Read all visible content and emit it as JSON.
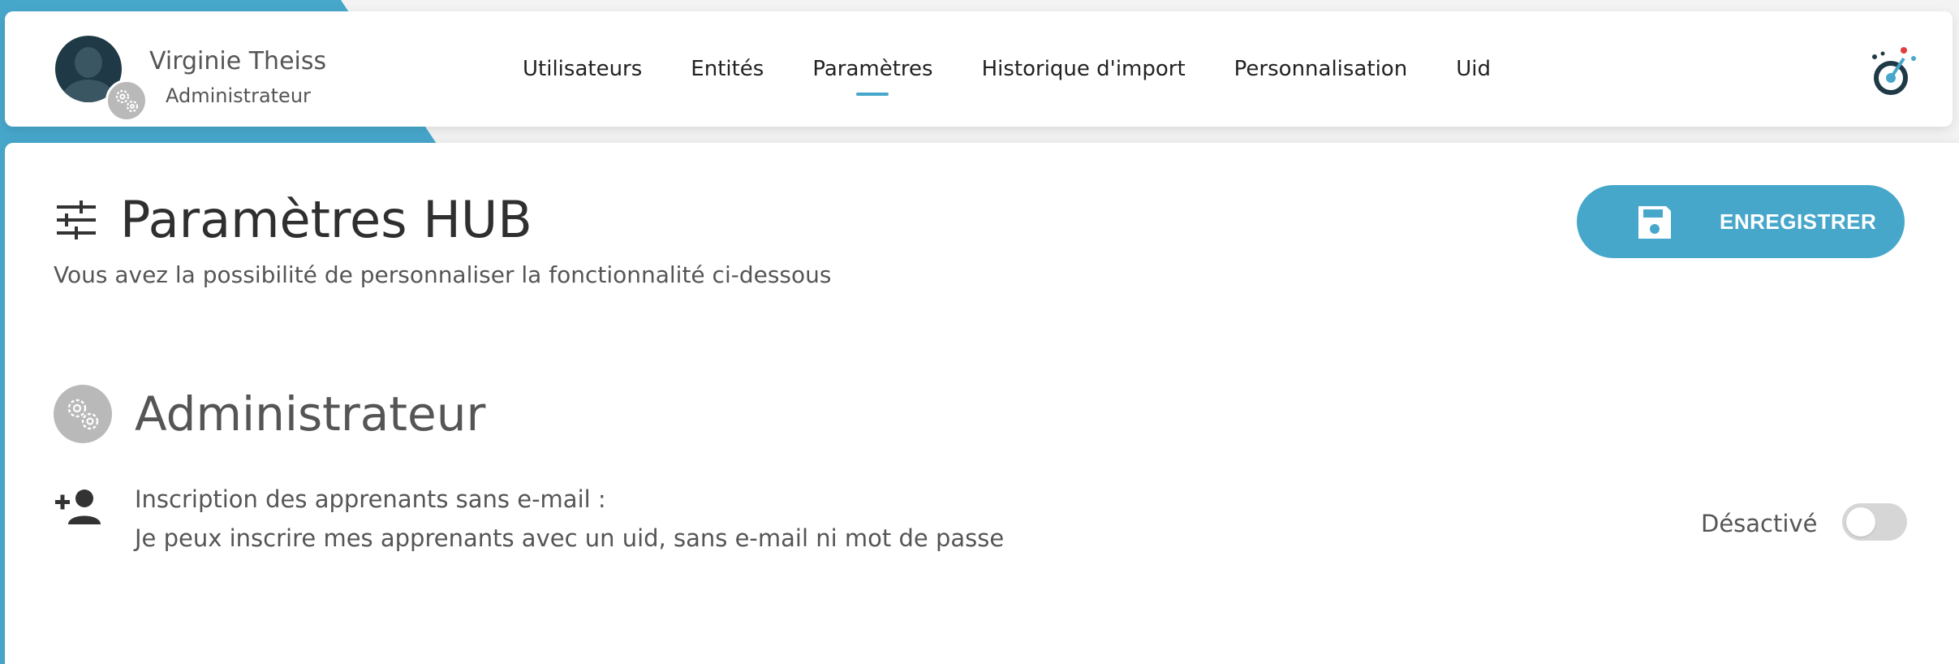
{
  "header": {
    "user": {
      "name": "Virginie Theiss",
      "role": "Administrateur",
      "avatar_icon": "user-avatar",
      "badge_icon": "gears-icon"
    },
    "nav": [
      {
        "label": "Utilisateurs",
        "active": false
      },
      {
        "label": "Entités",
        "active": false
      },
      {
        "label": "Paramètres",
        "active": true
      },
      {
        "label": "Historique d'import",
        "active": false
      },
      {
        "label": "Personnalisation",
        "active": false
      },
      {
        "label": "Uid",
        "active": false
      }
    ],
    "brand_icon": "target-logo-icon"
  },
  "main": {
    "title_icon": "sliders-icon",
    "title": "Paramètres HUB",
    "subtitle": "Vous avez la possibilité de personnaliser la fonctionnalité ci-dessous",
    "save_button": {
      "label": "ENREGISTRER",
      "icon": "floppy-disk-icon"
    },
    "section": {
      "icon": "gears-icon",
      "title": "Administrateur"
    },
    "setting": {
      "icon": "person-add-icon",
      "label": "Inscription des apprenants sans e-mail :",
      "description": "Je peux inscrire mes apprenants avec un uid, sans e-mail ni mot de passe",
      "status": "Désactivé",
      "enabled": false
    }
  },
  "colors": {
    "accent": "#47a7cb",
    "text": "#555555",
    "toggle_off": "#d6d6d6",
    "icon_grey": "#b9b9b9"
  }
}
